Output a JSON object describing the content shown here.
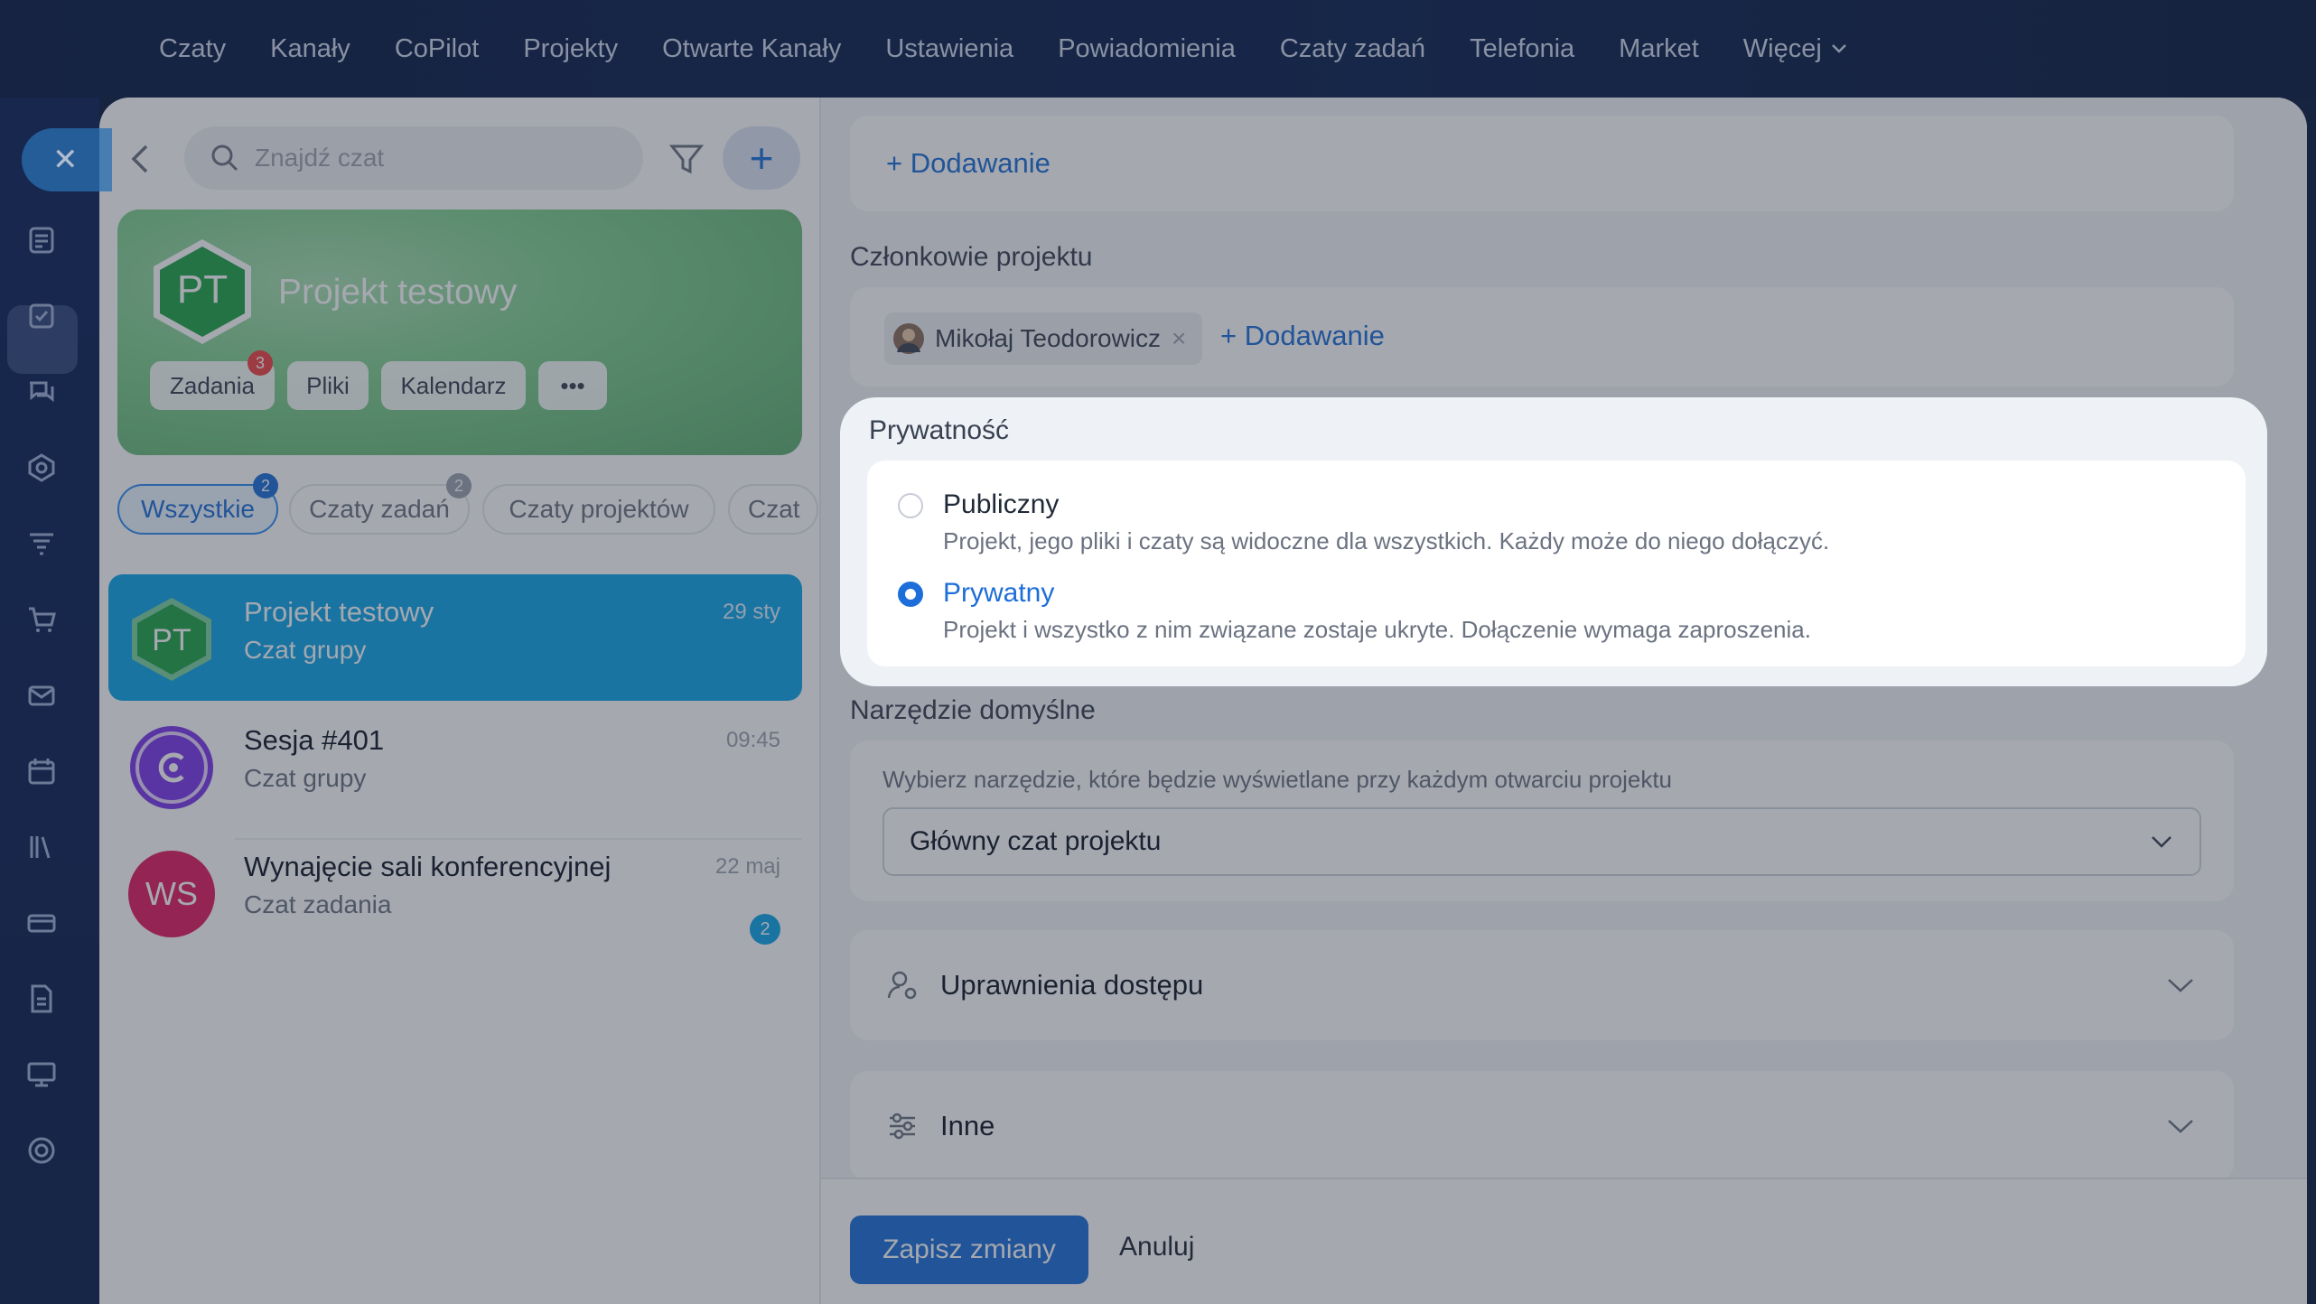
{
  "topnav": {
    "items": [
      "Czaty",
      "Kanały",
      "CoPilot",
      "Projekty",
      "Otwarte Kanały",
      "Ustawienia",
      "Powiadomienia",
      "Czaty zadań",
      "Telefonia",
      "Market",
      "Więcej"
    ]
  },
  "sidebar": {
    "icons": [
      "close-icon",
      "feed-icon",
      "tasks-icon",
      "chats-icon",
      "crm-icon",
      "funnel-icon",
      "cart-icon",
      "mail-icon",
      "calendar-icon",
      "library-icon",
      "card-icon",
      "document-icon",
      "presentation-icon",
      "target-icon"
    ]
  },
  "chatlist": {
    "search_placeholder": "Znajdź czat",
    "project_card": {
      "initials": "PT",
      "title": "Projekt testowy",
      "buttons": [
        {
          "label": "Zadania",
          "badge": "3"
        },
        {
          "label": "Pliki"
        },
        {
          "label": "Kalendarz"
        },
        {
          "label": "•••"
        }
      ]
    },
    "filters": [
      {
        "label": "Wszystkie",
        "badge": "2"
      },
      {
        "label": "Czaty zadań",
        "badge": "2"
      },
      {
        "label": "Czaty projektów"
      },
      {
        "label": "Czat"
      }
    ],
    "chats": [
      {
        "initials": "PT",
        "name": "Projekt testowy",
        "sub": "Czat grupy",
        "time": "29 sty"
      },
      {
        "initials": "",
        "name": "Sesja #401",
        "sub": "Czat grupy",
        "time": "09:45"
      },
      {
        "initials": "WS",
        "name": "Wynajęcie sali konferencyjnej",
        "sub": "Czat zadania",
        "time": "22 maj",
        "unread": "2"
      }
    ]
  },
  "settings": {
    "top_add": "+ Dodawanie",
    "members_label": "Członkowie projektu",
    "member_name": "Mikołaj Teodorowicz",
    "members_add": "+ Dodawanie",
    "privacy": {
      "title": "Prywatność",
      "options": [
        {
          "title": "Publiczny",
          "desc": "Projekt, jego pliki i czaty są widoczne dla wszystkich. Każdy może do niego dołączyć.",
          "selected": false
        },
        {
          "title": "Prywatny",
          "desc": "Projekt i wszystko z nim związane zostaje ukryte. Dołączenie wymaga zaproszenia.",
          "selected": true
        }
      ]
    },
    "default_tool_label": "Narzędzie domyślne",
    "default_tool_hint": "Wybierz narzędzie, które będzie wyświetlane przy każdym otwarciu projektu",
    "default_tool_value": "Główny czat projektu",
    "access_label": "Uprawnienia dostępu",
    "other_label": "Inne",
    "save_label": "Zapisz zmiany",
    "cancel_label": "Anuluj"
  },
  "colors": {
    "accent": "#1d6ed8",
    "selected_row": "#0ea5e9",
    "project_green": "#22a447",
    "badge_red": "#ef4444"
  }
}
